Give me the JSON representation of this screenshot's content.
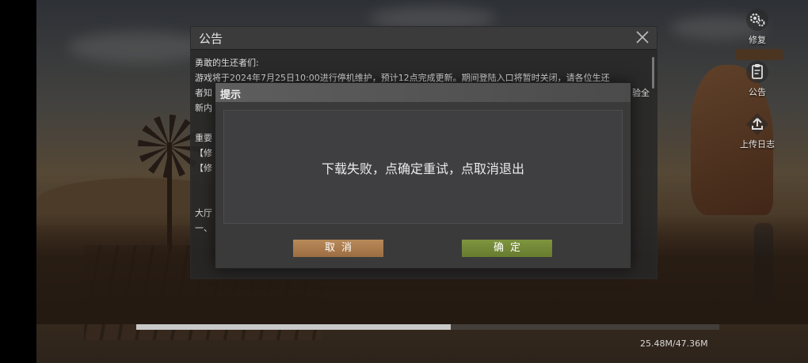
{
  "side_buttons": [
    {
      "label": "修复",
      "icon": "gears-icon"
    },
    {
      "label": "公告",
      "icon": "clipboard-icon"
    },
    {
      "label": "上传日志",
      "icon": "upload-icon"
    }
  ],
  "download": {
    "progress": 0.539,
    "size_text": "25.48M/47.36M"
  },
  "notice": {
    "title": "公告",
    "lines": [
      "勇敢的生还者们:",
      "游戏将于2024年7月25日10:00进行停机维护，预计12点完成更新。期间登陆入口将暂时关闭，请各位生还",
      "者知",
      "新内",
      "重要",
      "【修",
      "【修",
      "大厅",
      "一、"
    ],
    "line_right_fragment": "验全"
  },
  "dialog": {
    "title": "提示",
    "message": "下载失败，点确定重试，点取消退出",
    "cancel_label": "取消",
    "confirm_label": "确定"
  },
  "colors": {
    "cancel_button": "#a87a4e",
    "confirm_button": "#72883a"
  }
}
